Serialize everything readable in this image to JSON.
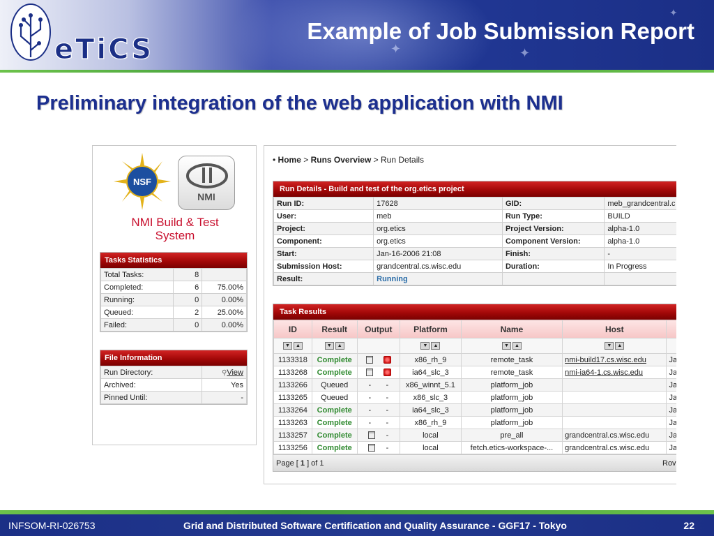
{
  "slide": {
    "title": "Example of Job Submission Report",
    "subtitle": "Preliminary integration of the web application with NMI",
    "logo_text": "eTiCS",
    "colors": {
      "header_blue": "#213895",
      "accent_green": "#6cc24a",
      "table_red": "#a30808",
      "nmi_red": "#c8102e"
    }
  },
  "left_panel": {
    "nsf_logo_text": "NSF",
    "nmi_logo_text": "NMI",
    "nmi_caption_line1": "NMI Build & Test",
    "nmi_caption_line2": "System",
    "tasks_statistics": {
      "title": "Tasks Statistics",
      "rows": [
        {
          "label": "Total Tasks:",
          "count": "8",
          "percent": ""
        },
        {
          "label": "Completed:",
          "count": "6",
          "percent": "75.00%"
        },
        {
          "label": "Running:",
          "count": "0",
          "percent": "0.00%"
        },
        {
          "label": "Queued:",
          "count": "2",
          "percent": "25.00%"
        },
        {
          "label": "Failed:",
          "count": "0",
          "percent": "0.00%"
        }
      ]
    },
    "file_information": {
      "title": "File Information",
      "rows": [
        {
          "label": "Run Directory:",
          "value": "View"
        },
        {
          "label": "Archived:",
          "value": "Yes"
        },
        {
          "label": "Pinned Until:",
          "value": "-"
        }
      ]
    }
  },
  "breadcrumb": {
    "bullet": "•",
    "home": "Home",
    "separator": ">",
    "runs_overview": "Runs Overview",
    "current": "Run Details"
  },
  "run_details": {
    "title": "Run Details - Build and test of the org.etics project",
    "rows": [
      {
        "l1": "Run ID:",
        "v1": "17628",
        "l2": "GID:",
        "v2": "meb_grandcentral.c"
      },
      {
        "l1": "User:",
        "v1": "meb",
        "l2": "Run Type:",
        "v2": "BUILD"
      },
      {
        "l1": "Project:",
        "v1": "org.etics",
        "l2": "Project Version:",
        "v2": "alpha-1.0"
      },
      {
        "l1": "Component:",
        "v1": "org.etics",
        "l2": "Component Version:",
        "v2": "alpha-1.0"
      },
      {
        "l1": "Start:",
        "v1": "Jan-16-2006 21:08",
        "l2": "Finish:",
        "v2": "-"
      },
      {
        "l1": "Submission Host:",
        "v1": "grandcentral.cs.wisc.edu",
        "l2": "Duration:",
        "v2": "In Progress"
      },
      {
        "l1": "Result:",
        "v1": "Running",
        "l2": "",
        "v2": ""
      }
    ]
  },
  "task_results": {
    "title": "Task Results",
    "columns": [
      "ID",
      "Result",
      "Output",
      "Platform",
      "Name",
      "Host"
    ],
    "sort_icons": {
      "down": "▼",
      "up": "▲"
    },
    "rows": [
      {
        "id": "1133318",
        "result": "Complete",
        "platform": "x86_rh_9",
        "name": "remote_task",
        "host": "nmi-build17.cs.wisc.edu",
        "extra": "Ja",
        "out": "icons"
      },
      {
        "id": "1133268",
        "result": "Complete",
        "platform": "ia64_slc_3",
        "name": "remote_task",
        "host": "nmi-ia64-1.cs.wisc.edu",
        "extra": "Ja",
        "out": "icons"
      },
      {
        "id": "1133266",
        "result": "Queued",
        "platform": "x86_winnt_5.1",
        "name": "platform_job",
        "host": "",
        "extra": "Ja",
        "out": "dash"
      },
      {
        "id": "1133265",
        "result": "Queued",
        "platform": "x86_slc_3",
        "name": "platform_job",
        "host": "",
        "extra": "Ja",
        "out": "dash"
      },
      {
        "id": "1133264",
        "result": "Complete",
        "platform": "ia64_slc_3",
        "name": "platform_job",
        "host": "",
        "extra": "Ja",
        "out": "dash"
      },
      {
        "id": "1133263",
        "result": "Complete",
        "platform": "x86_rh_9",
        "name": "platform_job",
        "host": "",
        "extra": "Ja",
        "out": "dash"
      },
      {
        "id": "1133257",
        "result": "Complete",
        "platform": "local",
        "name": "pre_all",
        "host": "grandcentral.cs.wisc.edu",
        "extra": "Ja",
        "out": "log"
      },
      {
        "id": "1133256",
        "result": "Complete",
        "platform": "local",
        "name": "fetch.etics-workspace-...",
        "host": "grandcentral.cs.wisc.edu",
        "extra": "Ja",
        "out": "log"
      }
    ],
    "dash": "-",
    "pager_prefix": "Page [",
    "pager_page": "1",
    "pager_suffix": "] of 1",
    "rows_label": "Rov"
  },
  "footer": {
    "left": "INFSOM-RI-026753",
    "center": "Grid and Distributed Software Certification and Quality Assurance - GGF17 - Tokyo",
    "page_number": "22"
  }
}
